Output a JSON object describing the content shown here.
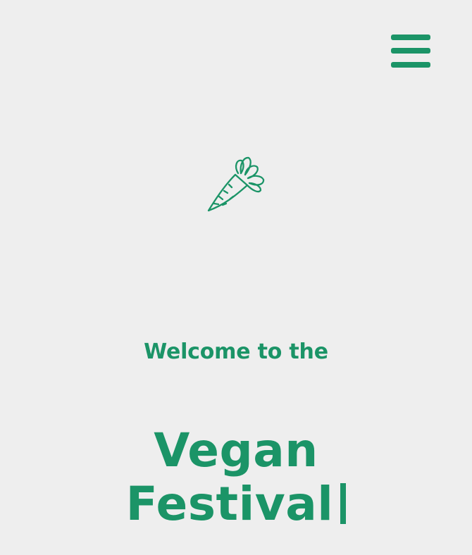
{
  "header": {
    "menu_icon": "hamburger-menu-icon"
  },
  "logo": {
    "icon": "carrot-icon"
  },
  "hero": {
    "welcome": "Welcome to the",
    "title_line1": "Vegan",
    "title_line2": "Festival"
  },
  "colors": {
    "accent": "#1b9467",
    "background": "#eeeeee"
  }
}
